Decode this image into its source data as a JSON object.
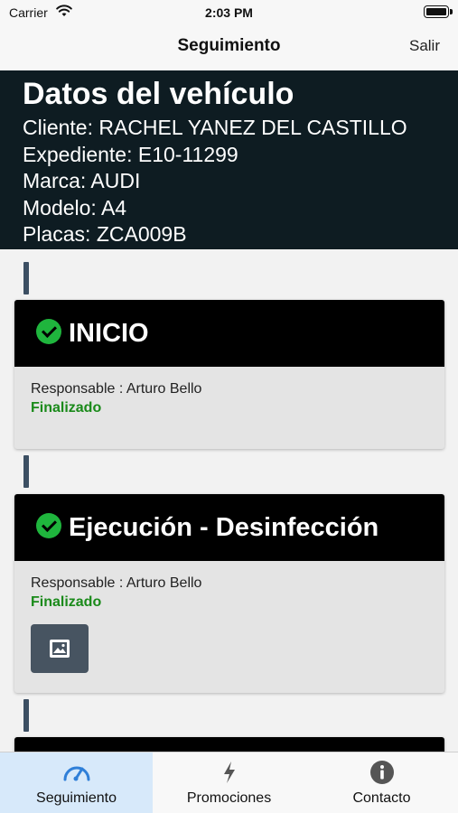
{
  "status_bar": {
    "carrier": "Carrier",
    "time": "2:03 PM"
  },
  "nav": {
    "title": "Seguimiento",
    "right_button": "Salir"
  },
  "vehicle": {
    "title": "Datos del vehículo",
    "lines": [
      "Cliente: RACHEL YANEZ DEL CASTILLO",
      "Expediente: E10-11299",
      "Marca: AUDI",
      "Modelo: A4",
      "Placas: ZCA009B"
    ]
  },
  "steps": [
    {
      "title": "INICIO",
      "responsible": "Responsable : Arturo Bello",
      "status": "Finalizado",
      "icon": "check-circle-icon"
    },
    {
      "title": "Ejecución - Desinfección",
      "responsible": "Responsable : Arturo Bello",
      "status": "Finalizado",
      "icon": "check-circle-icon",
      "attachment_icon": "image-icon"
    }
  ],
  "tabs": [
    {
      "label": "Seguimiento",
      "icon": "speedometer-icon",
      "active": true
    },
    {
      "label": "Promociones",
      "icon": "lightning-icon",
      "active": false
    },
    {
      "label": "Contacto",
      "icon": "info-icon",
      "active": false
    }
  ],
  "colors": {
    "header_bg": "#0e1c22",
    "card_head_bg": "#000000",
    "status_green": "#1a8a1a",
    "check_green": "#1fb53d",
    "active_tab_bg": "#d7e9fa",
    "tab_accent": "#2f7fd8"
  }
}
